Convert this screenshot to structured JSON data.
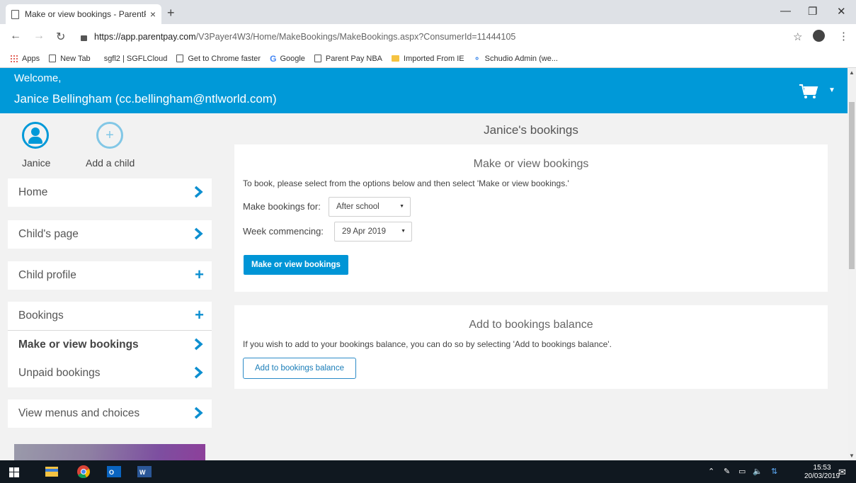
{
  "browser": {
    "tab_title": "Make or view bookings - ParentP",
    "tab_close": "×",
    "new_tab": "+",
    "url_host": "https://app.parentpay.com",
    "url_path": "/V3Payer4W3/Home/MakeBookings/MakeBookings.aspx?ConsumerId=11444105",
    "bookmarks": [
      {
        "label": "Apps",
        "icon": "apps-icon"
      },
      {
        "label": "New Tab",
        "icon": "page-icon"
      },
      {
        "label": "sgfl2 | SGFLCloud",
        "icon": "none"
      },
      {
        "label": "Get to Chrome faster",
        "icon": "page-icon"
      },
      {
        "label": "Google",
        "icon": "google-icon"
      },
      {
        "label": "Parent Pay NBA",
        "icon": "page-icon"
      },
      {
        "label": "Imported From IE",
        "icon": "folder-icon"
      },
      {
        "label": "Schudio Admin (we...",
        "icon": "rss-icon"
      }
    ]
  },
  "header": {
    "welcome": "Welcome,",
    "user": "Janice Bellingham (cc.bellingham@ntlworld.com)"
  },
  "sidebar": {
    "profile_name": "Janice",
    "add_child": "Add a child",
    "items": [
      {
        "label": "Home",
        "action": "chevron"
      },
      {
        "label": "Child's page",
        "action": "chevron"
      },
      {
        "label": "Child profile",
        "action": "plus"
      },
      {
        "label": "Bookings",
        "action": "plus"
      },
      {
        "label": "Make or view bookings",
        "action": "chevron"
      },
      {
        "label": "Unpaid bookings",
        "action": "chevron"
      },
      {
        "label": "View menus and choices",
        "action": "chevron"
      }
    ]
  },
  "main": {
    "page_title": "Janice's bookings",
    "make_panel": {
      "title": "Make or view bookings",
      "instruction": "To book, please select from the options below and then select 'Make or view bookings.'",
      "bookings_for_label": "Make bookings for:",
      "bookings_for_value": "After school",
      "week_label": "Week commencing:",
      "week_value": "29 Apr 2019",
      "button": "Make or view bookings"
    },
    "balance_panel": {
      "title": "Add to bookings balance",
      "text": "If you wish to add to your bookings balance, you can do so by selecting 'Add to bookings balance'.",
      "button": "Add to bookings balance"
    }
  },
  "taskbar": {
    "time": "15:53",
    "date": "20/03/2019"
  },
  "colors": {
    "brand": "#0099d8",
    "nav_icon": "#0d8fd0"
  }
}
